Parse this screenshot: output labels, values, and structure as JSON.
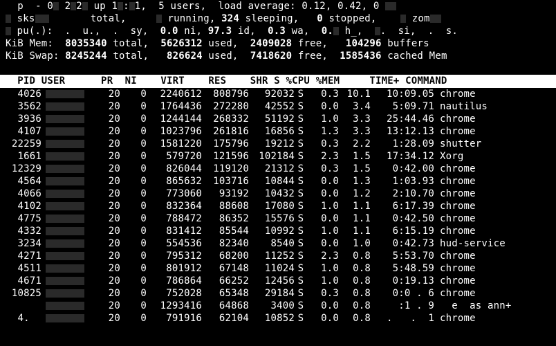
{
  "summary": {
    "uptime_line": {
      "prefix": "  p  - 0",
      "mid1": " 2",
      "mid2": "2",
      "mid3": " up 1",
      "mid4": ":",
      "mid5": "1,  ",
      "users": "5 users,",
      "load_label": "  load average: ",
      "load1": "0.12",
      "comma": ", ",
      "load2": "0.42",
      "comma2": ", ",
      "load3_partial": "0 "
    },
    "tasks_line": {
      "label": " sks",
      "gap": "       total,     ",
      "running": "running, ",
      "sleeping_val": "324",
      "sleeping": " sleeping,   ",
      "stopped_val": "0",
      "stopped": " stopped,    ",
      "zomb": "zom"
    },
    "cpu_line": {
      "label": " pu(.):  .  u.,  .  sy,  ",
      "ni": "0.0",
      "ni_l": " ni, ",
      "id": "97.3",
      "id_l": " id,  ",
      "wa": "0.3",
      "wa_l": " wa,  ",
      "hi": "0.",
      "hi_l": " h_,  ",
      "si": "",
      "si_l": ".  si,  .  s."
    },
    "mem_line": {
      "label": "KiB Mem:  ",
      "total": "8035340",
      "tl": " total,  ",
      "used": "5626312",
      "ul": " used,  ",
      "free": "2409028",
      "fl": " free,   ",
      "buf": "104296",
      "bl": " buffers"
    },
    "swap_line": {
      "label": "KiB Swap: ",
      "total": "8245244",
      "tl": " total,   ",
      "used": "826624",
      "ul": " used,  ",
      "free": "7418620",
      "fl": " free,  ",
      "cache": "1585436",
      "cl": " cached Mem"
    }
  },
  "columns": "  PID USER      PR  NI    VIRT    RES    SHR S %CPU %MEM     TIME+ COMMAND           ",
  "processes": [
    {
      "pid": "4026",
      "pr": "20",
      "ni": "0",
      "virt": "2240612",
      "res": "808796",
      "shr": "92032",
      "s": "S",
      "cpu": "0.3",
      "mem": "10.1",
      "time": "10:09.05",
      "cmd": "chrome"
    },
    {
      "pid": "3562",
      "pr": "20",
      "ni": "0",
      "virt": "1764436",
      "res": "272280",
      "shr": "42552",
      "s": "S",
      "cpu": "0.0",
      "mem": "3.4",
      "time": "5:09.71",
      "cmd": "nautilus"
    },
    {
      "pid": "3936",
      "pr": "20",
      "ni": "0",
      "virt": "1244144",
      "res": "268332",
      "shr": "51192",
      "s": "S",
      "cpu": "1.0",
      "mem": "3.3",
      "time": "25:44.46",
      "cmd": "chrome"
    },
    {
      "pid": "4107",
      "pr": "20",
      "ni": "0",
      "virt": "1023796",
      "res": "261816",
      "shr": "16856",
      "s": "S",
      "cpu": "1.3",
      "mem": "3.3",
      "time": "13:12.13",
      "cmd": "chrome"
    },
    {
      "pid": "22259",
      "pr": "20",
      "ni": "0",
      "virt": "1581220",
      "res": "175796",
      "shr": "19212",
      "s": "S",
      "cpu": "0.3",
      "mem": "2.2",
      "time": "1:28.09",
      "cmd": "shutter"
    },
    {
      "pid": "1661",
      "pr": "20",
      "ni": "0",
      "virt": "579720",
      "res": "121596",
      "shr": "102184",
      "s": "S",
      "cpu": "2.3",
      "mem": "1.5",
      "time": "17:34.12",
      "cmd": "Xorg"
    },
    {
      "pid": "12329",
      "pr": "20",
      "ni": "0",
      "virt": "826044",
      "res": "119120",
      "shr": "21312",
      "s": "S",
      "cpu": "0.3",
      "mem": "1.5",
      "time": "0:42.00",
      "cmd": "chrome"
    },
    {
      "pid": "4564",
      "pr": "20",
      "ni": "0",
      "virt": "865632",
      "res": "103716",
      "shr": "10844",
      "s": "S",
      "cpu": "0.0",
      "mem": "1.3",
      "time": "1:03.93",
      "cmd": "chrome"
    },
    {
      "pid": "4066",
      "pr": "20",
      "ni": "0",
      "virt": "773060",
      "res": "93192",
      "shr": "10432",
      "s": "S",
      "cpu": "0.0",
      "mem": "1.2",
      "time": "2:10.70",
      "cmd": "chrome"
    },
    {
      "pid": "4102",
      "pr": "20",
      "ni": "0",
      "virt": "832364",
      "res": "88608",
      "shr": "17080",
      "s": "S",
      "cpu": "1.0",
      "mem": "1.1",
      "time": "6:17.39",
      "cmd": "chrome"
    },
    {
      "pid": "4775",
      "pr": "20",
      "ni": "0",
      "virt": "788472",
      "res": "86352",
      "shr": "15576",
      "s": "S",
      "cpu": "0.0",
      "mem": "1.1",
      "time": "0:42.50",
      "cmd": "chrome"
    },
    {
      "pid": "4332",
      "pr": "20",
      "ni": "0",
      "virt": "831412",
      "res": "85544",
      "shr": "10992",
      "s": "S",
      "cpu": "1.0",
      "mem": "1.1",
      "time": "6:15.19",
      "cmd": "chrome"
    },
    {
      "pid": "3234",
      "pr": "20",
      "ni": "0",
      "virt": "554536",
      "res": "82340",
      "shr": "8540",
      "s": "S",
      "cpu": "0.0",
      "mem": "1.0",
      "time": "0:42.73",
      "cmd": "hud-service"
    },
    {
      "pid": "4271",
      "pr": "20",
      "ni": "0",
      "virt": "795312",
      "res": "68200",
      "shr": "11252",
      "s": "S",
      "cpu": "2.3",
      "mem": "0.8",
      "time": "5:53.70",
      "cmd": "chrome"
    },
    {
      "pid": "4511",
      "pr": "20",
      "ni": "0",
      "virt": "801912",
      "res": "67148",
      "shr": "11024",
      "s": "S",
      "cpu": "1.0",
      "mem": "0.8",
      "time": "5:48.59",
      "cmd": "chrome"
    },
    {
      "pid": "4671",
      "pr": "20",
      "ni": "0",
      "virt": "786864",
      "res": "66252",
      "shr": "12456",
      "s": "S",
      "cpu": "1.0",
      "mem": "0.8",
      "time": "0:19.13",
      "cmd": "chrome"
    },
    {
      "pid": "10825",
      "pr": "20",
      "ni": "0",
      "virt": "752028",
      "res": "65348",
      "shr": "29184",
      "s": "S",
      "cpu": "0.3",
      "mem": "0.8",
      "time": "0:0 . 6",
      "cmd": "chrome"
    },
    {
      "pid": "    ",
      "pr": "20",
      "ni": "0",
      "virt": "1293416",
      "res": "64868",
      "shr": "3400",
      "s": "S",
      "cpu": "0.0",
      "mem": "0.8",
      "time": "  :1 . 9",
      "cmd": "  e  as ann+"
    },
    {
      "pid": "4.  ",
      "pr": "20",
      "ni": "0",
      "virt": "791916",
      "res": "62104",
      "shr": "10852",
      "s": "S",
      "cpu": "0.0",
      "mem": "0.8",
      "time": ".   .  1",
      "cmd": "chrome"
    }
  ]
}
